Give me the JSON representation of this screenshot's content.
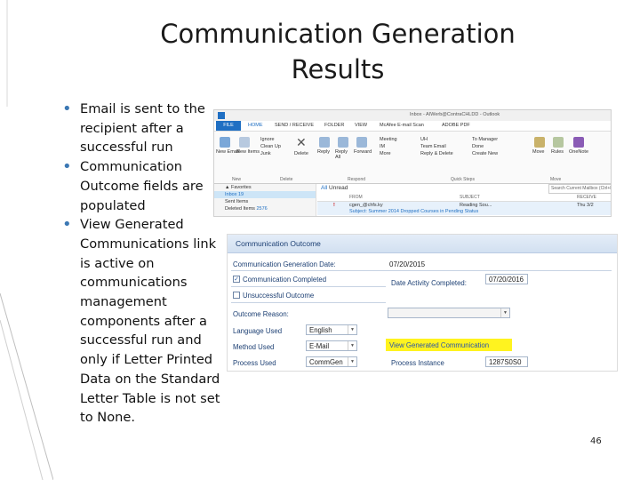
{
  "slide": {
    "title_line1": "Communication Generation",
    "title_line2": "Results",
    "page_number": "46",
    "bullets": [
      "Email is sent to the recipient after a successful run",
      "Communication Outcome fields are populated",
      "View Generated Communications link is active on communications management components after a successful run and only if Letter Printed Data on the Standard Letter Table is not set to None."
    ],
    "accent_color": "#3c78b4"
  },
  "outlook": {
    "window_title": "Inbox - AIWerb@ContraCHLDD - Outlook",
    "tabs": [
      "FILE",
      "HOME",
      "SEND / RECEIVE",
      "FOLDER",
      "VIEW",
      "McAfee E-mail Scan",
      "ADOBE PDF"
    ],
    "ribbon_buttons": {
      "new_email": "New Email",
      "new_items": "New Items",
      "ignore": "Ignore",
      "cleanup": "Clean Up",
      "junk": "Junk",
      "delete": "Delete",
      "reply": "Reply",
      "reply_all": "Reply All",
      "forward": "Forward",
      "meeting": "Meeting",
      "im": "IM",
      "more": "More",
      "uh": "UH",
      "team_email": "Team Email",
      "reply_delete": "Reply & Delete",
      "to_manager": "To Manager",
      "done": "Done",
      "create_new": "Create New",
      "move": "Move",
      "rules": "Rules",
      "onenote": "OneNote"
    },
    "ribbon_groups": [
      "New",
      "Delete",
      "Respond",
      "Quick Steps",
      "Move"
    ],
    "search_placeholder": "Search Current Mailbox (Ctrl+E)",
    "nav": {
      "favorites": "▲ Favorites",
      "inbox": "Inbox",
      "inbox_count": "19",
      "sent_items": "Sent Items",
      "deleted_items": "Deleted Items",
      "deleted_count": "2576"
    },
    "list_filters": {
      "all": "All",
      "unread": "Unread"
    },
    "list_headers": {
      "from": "FROM",
      "subject": "SUBJECT",
      "received": "RECEIVE"
    },
    "email": {
      "from": "cgen_@chfs.ky",
      "subject": "Reading Sou...",
      "received": "Thu 3/2",
      "preview": "Subject: Summer 2014 Dropped Courses in Pending Status"
    },
    "colors": {
      "file_tab": "#1f6fc3",
      "selection": "#cde5f7"
    }
  },
  "outcome": {
    "header": "Communication Outcome",
    "gen_date_label": "Communication Generation Date:",
    "gen_date_value": "07/20/2015",
    "completed_label": "Communication Completed",
    "completed_checked": true,
    "date_activity_label": "Date Activity Completed:",
    "date_activity_value": "07/20/2016",
    "unsuccessful_label": "Unsuccessful Outcome",
    "unsuccessful_checked": false,
    "reason_label": "Outcome Reason:",
    "language_label": "Language Used",
    "language_value": "English",
    "method_label": "Method Used",
    "method_value": "E-Mail",
    "process_label": "Process Used",
    "process_value": "CommGen",
    "process_instance_label": "Process Instance",
    "process_instance_value": "1287S0S0",
    "view_link": "View Generated Communication",
    "highlight_color": "#fff31f"
  }
}
